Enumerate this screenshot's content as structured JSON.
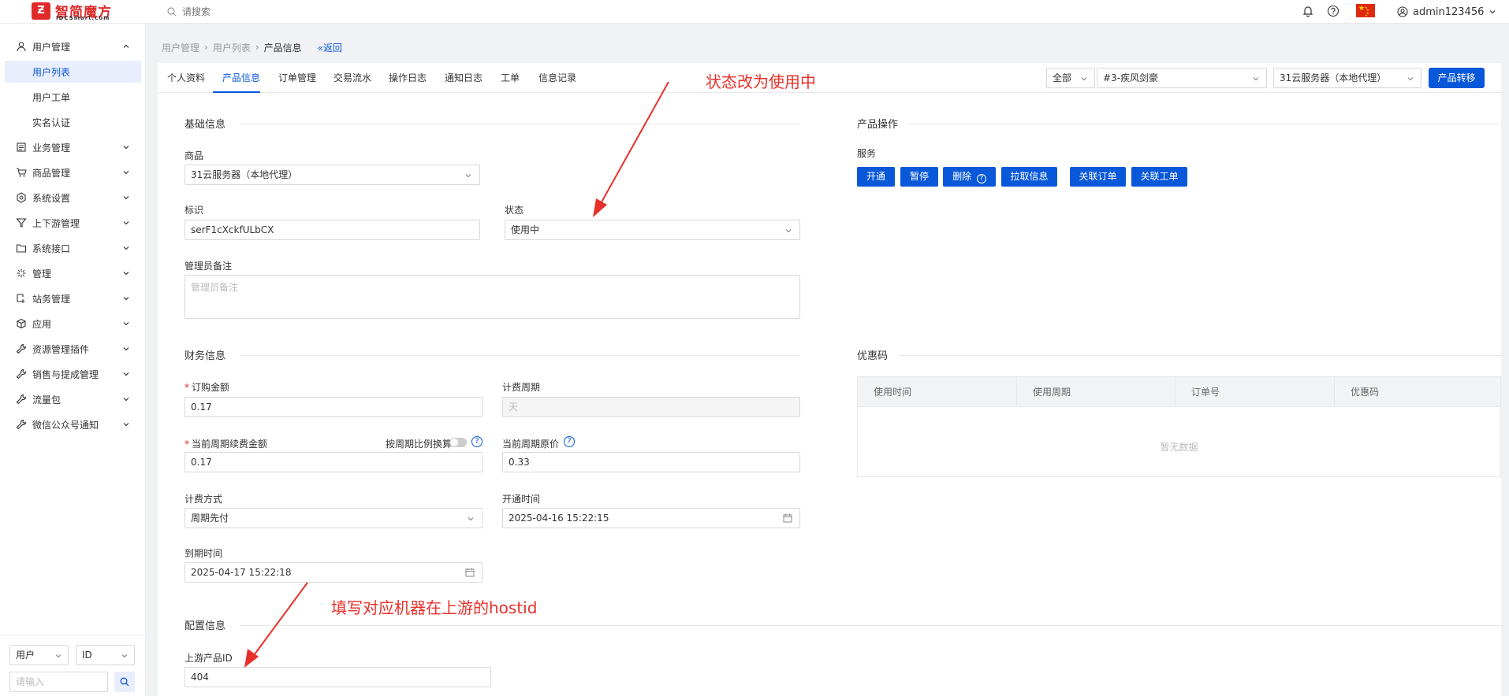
{
  "brand": {
    "logo_mark": "Ƶ",
    "name": "智简魔方",
    "sub": "IDCSmart.com"
  },
  "topbar": {
    "search_placeholder": "请搜索",
    "username": "admin123456"
  },
  "sidebar": {
    "group_open": "用户管理",
    "sub_items": [
      "用户列表",
      "用户工单",
      "实名认证"
    ],
    "items": [
      "业务管理",
      "商品管理",
      "系统设置",
      "上下游管理",
      "系统接口",
      "管理",
      "站务管理",
      "应用",
      "资源管理插件",
      "销售与提成管理",
      "流量包",
      "微信公众号通知"
    ],
    "bottom": {
      "type_select": "用户",
      "field_select": "ID",
      "input_placeholder": "请输入"
    }
  },
  "breadcrumb": {
    "items": [
      "用户管理",
      "用户列表"
    ],
    "current": "产品信息",
    "back": "返回"
  },
  "tabs": [
    "个人资料",
    "产品信息",
    "订单管理",
    "交易流水",
    "操作日志",
    "通知日志",
    "工单",
    "信息记录"
  ],
  "filters": {
    "scope": "全部",
    "host": "#3-疾风剑豪",
    "product": "31云服务器（本地代理）",
    "transfer_button": "产品转移"
  },
  "basic": {
    "title": "基础信息",
    "product_label": "商品",
    "product_value": "31云服务器（本地代理）",
    "tag_label": "标识",
    "tag_value": "serF1cXckfULbCX",
    "status_label": "状态",
    "status_value": "使用中",
    "note_label": "管理员备注",
    "note_placeholder": "管理员备注"
  },
  "ops": {
    "title": "产品操作",
    "service_label": "服务",
    "buttons": [
      "开通",
      "暂停",
      "删除",
      "拉取信息",
      "关联订单",
      "关联工单"
    ]
  },
  "finance": {
    "title": "财务信息",
    "order_amount_label": "订购金额",
    "order_amount": "0.17",
    "cycle_label": "计费周期",
    "cycle_value": "天",
    "renew_label": "当前周期续费金额",
    "renew_amount": "0.17",
    "prorate_label": "按周期比例换算",
    "orig_price_label": "当前周期原价",
    "orig_price": "0.33",
    "billing_label": "计费方式",
    "billing_value": "周期先付",
    "open_time_label": "开通时间",
    "open_time": "2025-04-16 15:22:15",
    "expire_label": "到期时间",
    "expire_time": "2025-04-17 15:22:18"
  },
  "coupon": {
    "title": "优惠码",
    "columns": [
      "使用时间",
      "使用周期",
      "订单号",
      "优惠码"
    ],
    "empty": "暂无数据"
  },
  "config": {
    "title": "配置信息",
    "upstream_label": "上游产品ID",
    "upstream_value": "404"
  },
  "annotations": {
    "status_note": "状态改为使用中",
    "hostid_note": "填写对应机器在上游的hostid"
  },
  "colors": {
    "primary": "#0958d9",
    "annotation": "#e8302a",
    "brand": "#e02a2a"
  }
}
